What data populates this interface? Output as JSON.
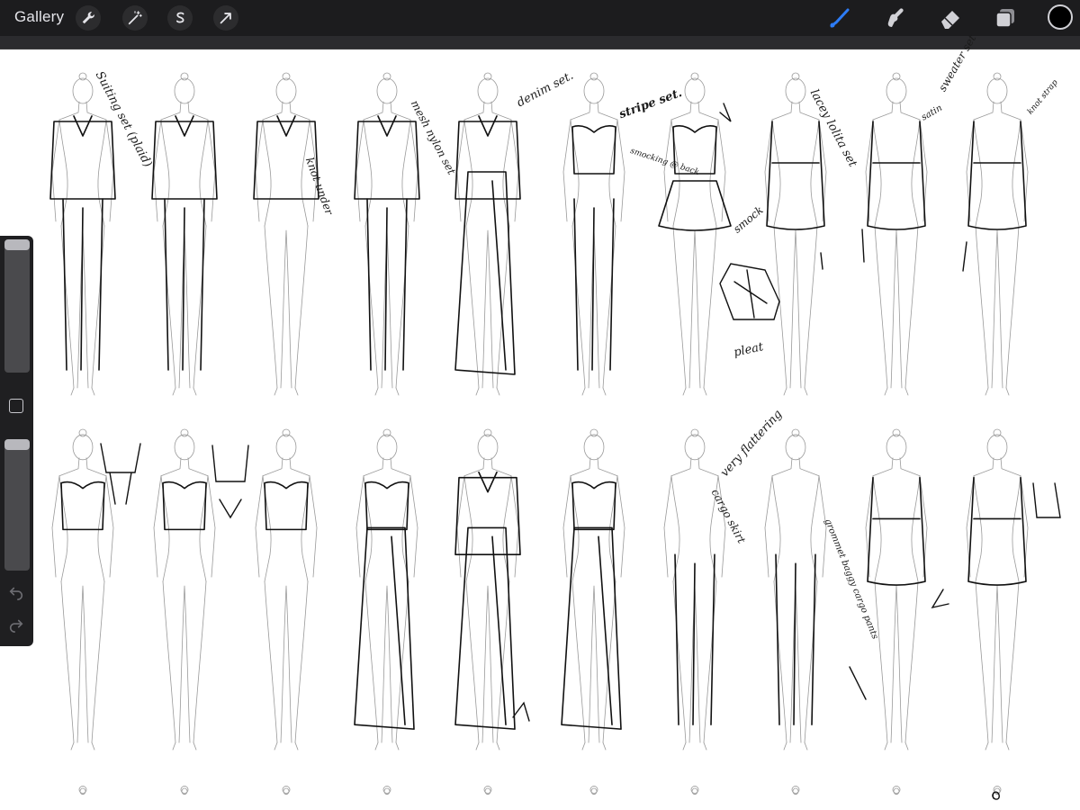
{
  "app": {
    "gallery_label": "Gallery"
  },
  "toolbar": {
    "left_tools": [
      "wrench-icon",
      "magic-wand-icon",
      "selection-s-icon",
      "transform-arrow-icon"
    ],
    "right_tools": [
      "brush-icon",
      "smudge-icon",
      "eraser-icon",
      "layers-icon"
    ],
    "active_tool": "brush-icon",
    "accent_color": "#2d7cf6",
    "current_color": "#000000"
  },
  "sidebar": {
    "brush_size_level": 1.0,
    "opacity_level": 1.0
  },
  "annotations": {
    "row1": [
      "Suiting set (plaid)",
      "knot under",
      "mesh nylon set",
      "denim set.",
      "stripe set.",
      "smocking @ back",
      "lacey lolita set",
      "satin",
      "sweater set",
      "smock",
      "pleat",
      "knot strap"
    ],
    "row2": [
      "very flattering",
      "cargo skirt",
      "grommet baggy cargo pants"
    ]
  }
}
